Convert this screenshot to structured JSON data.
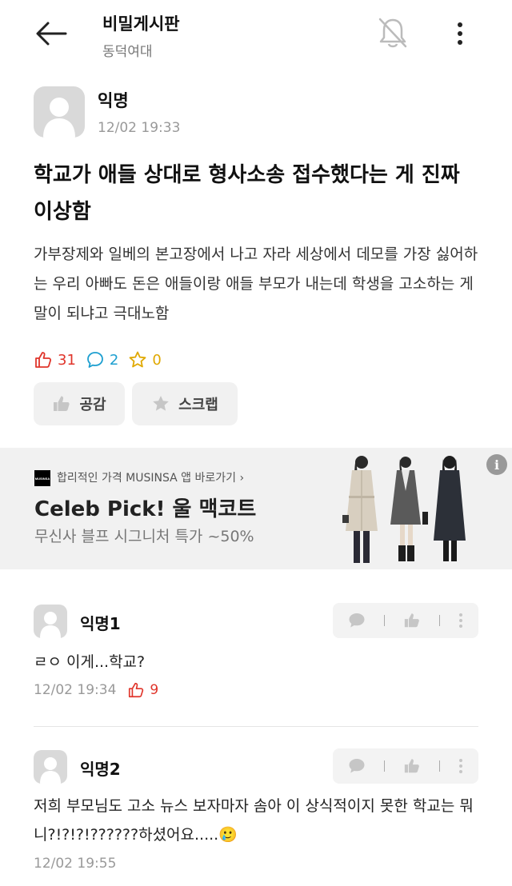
{
  "header": {
    "board_title": "비밀게시판",
    "school": "동덕여대"
  },
  "post": {
    "author": "익명",
    "time": "12/02 19:33",
    "title": "학교가 애들 상대로 형사소송 접수했다는 게 진짜 이상함",
    "body": "가부장제와 일베의 본고장에서 나고 자라 세상에서 데모를 가장 싫어하는 우리 아빠도 돈은 애들이랑 애들 부모가 내는데 학생을 고소하는 게 말이 되냐고 극대노함",
    "likes": "31",
    "comments": "2",
    "scraps": "0",
    "like_button": "공감",
    "scrap_button": "스크랩"
  },
  "ad": {
    "logo_text": "MUSINSA",
    "sponsor": "합리적인 가격 MUSINSA 앱 바로가기 ›",
    "headline": "Celeb Pick! 울 맥코트",
    "subline": "무신사 블프 시그니처 특가 ~50%",
    "info": "i"
  },
  "comments": [
    {
      "author": "익명1",
      "body": "ㄹㅇ 이게...학교?",
      "time": "12/02 19:34",
      "likes": "9"
    },
    {
      "author": "익명2",
      "body": "저희 부모님도 고소 뉴스 보자마자 솜아 이 상식적이지 못한 학교는 뭐니?!?!?!??????하셨어요.....🥲",
      "time": "12/02 19:55",
      "likes": ""
    }
  ],
  "colors": {
    "like": "#e0352b",
    "comment": "#1d9fd0",
    "scrap": "#e0a800"
  },
  "icons": [
    "back-arrow-icon",
    "bell-off-icon",
    "more-vertical-icon",
    "thumbs-up-icon",
    "speech-bubble-icon",
    "star-icon",
    "info-icon"
  ]
}
